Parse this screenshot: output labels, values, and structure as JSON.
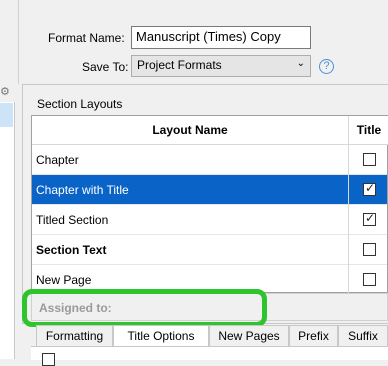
{
  "format_name": {
    "label": "Format Name:",
    "value": "Manuscript (Times) Copy"
  },
  "save_to": {
    "label": "Save To:",
    "value": "Project Formats",
    "help": "?"
  },
  "section_layouts": {
    "title": "Section Layouts",
    "columns": [
      "Layout Name",
      "Title"
    ],
    "rows": [
      {
        "name": "Chapter",
        "title_checked": false,
        "selected": false,
        "bold": false
      },
      {
        "name": "Chapter with Title",
        "title_checked": true,
        "selected": true,
        "bold": false
      },
      {
        "name": "Titled Section",
        "title_checked": true,
        "selected": false,
        "bold": false
      },
      {
        "name": "Section Text",
        "title_checked": false,
        "selected": false,
        "bold": true
      },
      {
        "name": "New Page",
        "title_checked": false,
        "selected": false,
        "bold": false
      }
    ]
  },
  "assigned_to": {
    "label": "Assigned to:"
  },
  "tabs": [
    "Formatting",
    "Title Options",
    "New Pages",
    "Prefix",
    "Suffix"
  ],
  "colors": {
    "selection": "#0a64c8",
    "highlight": "#2ec42e"
  }
}
